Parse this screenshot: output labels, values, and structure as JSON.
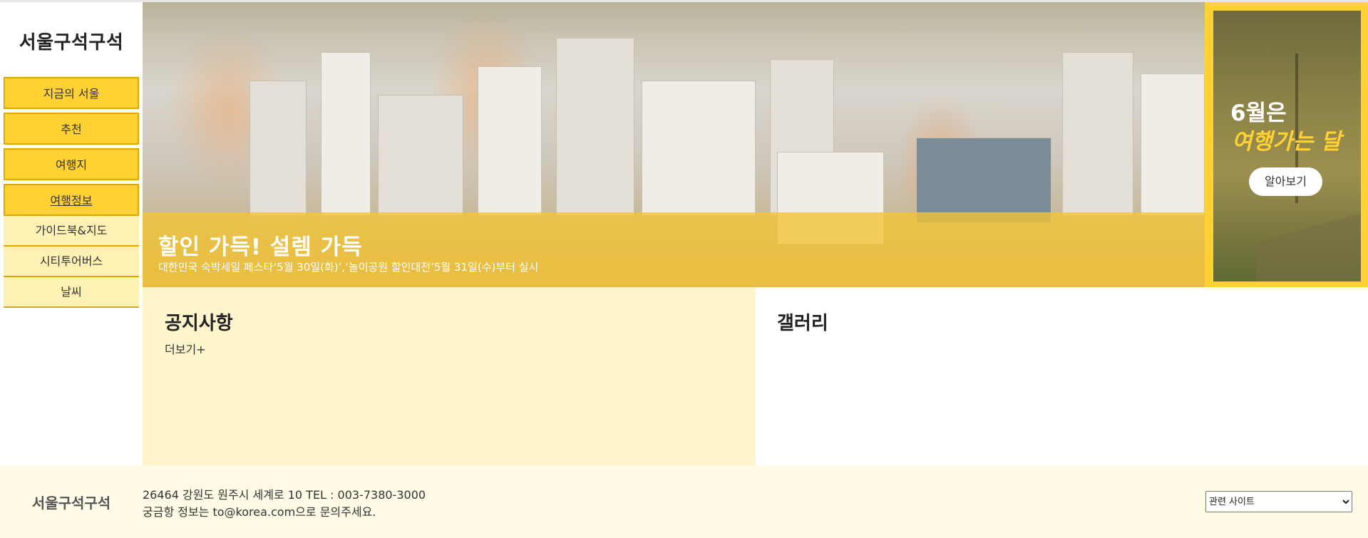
{
  "header": {
    "logo": "서울구석구석"
  },
  "sidebar": {
    "items": [
      {
        "label": "지금의 서울"
      },
      {
        "label": "추천"
      },
      {
        "label": "여행지"
      },
      {
        "label": "여행정보"
      },
      {
        "label": "가이드북&지도"
      },
      {
        "label": "시티투어버스"
      },
      {
        "label": "날씨"
      }
    ]
  },
  "hero": {
    "title": "할인 가득! 설렘 가득",
    "description": "대한민국 숙박세일 페스타‘5월 30일(화)’,‘놀이공원 할인대전’5월 31일(수)부터 실시"
  },
  "promo": {
    "line1": "6월은",
    "line2": "여행가는 달",
    "button": "알아보기"
  },
  "notice": {
    "title": "공지사항",
    "more": "더보기+"
  },
  "gallery": {
    "title": "갤러리"
  },
  "footer": {
    "logo": "서울구석구석",
    "address": "26464 강원도 원주시 세계로 10 TEL : 003-7380-3000",
    "contact": "궁금항 정보는 to@korea.com으로 문의주세요.",
    "select": {
      "selected": "관련 사이트"
    }
  },
  "colors": {
    "accent": "#ffd133",
    "accent_border": "#e0a700",
    "submenu_bg": "#fff0b3",
    "notice_bg": "#fff5cc",
    "footer_bg": "#fffbe6"
  }
}
